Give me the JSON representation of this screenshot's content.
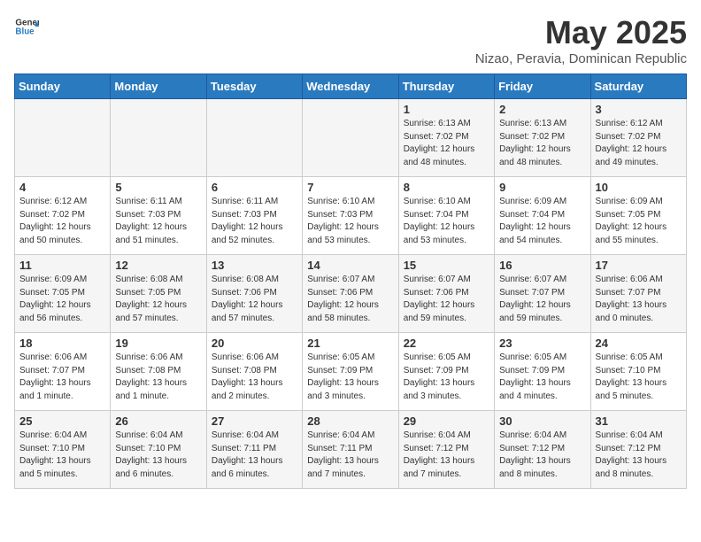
{
  "header": {
    "logo_general": "General",
    "logo_blue": "Blue",
    "title": "May 2025",
    "subtitle": "Nizao, Peravia, Dominican Republic"
  },
  "days_of_week": [
    "Sunday",
    "Monday",
    "Tuesday",
    "Wednesday",
    "Thursday",
    "Friday",
    "Saturday"
  ],
  "weeks": [
    [
      {
        "day": "",
        "info": ""
      },
      {
        "day": "",
        "info": ""
      },
      {
        "day": "",
        "info": ""
      },
      {
        "day": "",
        "info": ""
      },
      {
        "day": "1",
        "info": "Sunrise: 6:13 AM\nSunset: 7:02 PM\nDaylight: 12 hours\nand 48 minutes."
      },
      {
        "day": "2",
        "info": "Sunrise: 6:13 AM\nSunset: 7:02 PM\nDaylight: 12 hours\nand 48 minutes."
      },
      {
        "day": "3",
        "info": "Sunrise: 6:12 AM\nSunset: 7:02 PM\nDaylight: 12 hours\nand 49 minutes."
      }
    ],
    [
      {
        "day": "4",
        "info": "Sunrise: 6:12 AM\nSunset: 7:02 PM\nDaylight: 12 hours\nand 50 minutes."
      },
      {
        "day": "5",
        "info": "Sunrise: 6:11 AM\nSunset: 7:03 PM\nDaylight: 12 hours\nand 51 minutes."
      },
      {
        "day": "6",
        "info": "Sunrise: 6:11 AM\nSunset: 7:03 PM\nDaylight: 12 hours\nand 52 minutes."
      },
      {
        "day": "7",
        "info": "Sunrise: 6:10 AM\nSunset: 7:03 PM\nDaylight: 12 hours\nand 53 minutes."
      },
      {
        "day": "8",
        "info": "Sunrise: 6:10 AM\nSunset: 7:04 PM\nDaylight: 12 hours\nand 53 minutes."
      },
      {
        "day": "9",
        "info": "Sunrise: 6:09 AM\nSunset: 7:04 PM\nDaylight: 12 hours\nand 54 minutes."
      },
      {
        "day": "10",
        "info": "Sunrise: 6:09 AM\nSunset: 7:05 PM\nDaylight: 12 hours\nand 55 minutes."
      }
    ],
    [
      {
        "day": "11",
        "info": "Sunrise: 6:09 AM\nSunset: 7:05 PM\nDaylight: 12 hours\nand 56 minutes."
      },
      {
        "day": "12",
        "info": "Sunrise: 6:08 AM\nSunset: 7:05 PM\nDaylight: 12 hours\nand 57 minutes."
      },
      {
        "day": "13",
        "info": "Sunrise: 6:08 AM\nSunset: 7:06 PM\nDaylight: 12 hours\nand 57 minutes."
      },
      {
        "day": "14",
        "info": "Sunrise: 6:07 AM\nSunset: 7:06 PM\nDaylight: 12 hours\nand 58 minutes."
      },
      {
        "day": "15",
        "info": "Sunrise: 6:07 AM\nSunset: 7:06 PM\nDaylight: 12 hours\nand 59 minutes."
      },
      {
        "day": "16",
        "info": "Sunrise: 6:07 AM\nSunset: 7:07 PM\nDaylight: 12 hours\nand 59 minutes."
      },
      {
        "day": "17",
        "info": "Sunrise: 6:06 AM\nSunset: 7:07 PM\nDaylight: 13 hours\nand 0 minutes."
      }
    ],
    [
      {
        "day": "18",
        "info": "Sunrise: 6:06 AM\nSunset: 7:07 PM\nDaylight: 13 hours\nand 1 minute."
      },
      {
        "day": "19",
        "info": "Sunrise: 6:06 AM\nSunset: 7:08 PM\nDaylight: 13 hours\nand 1 minute."
      },
      {
        "day": "20",
        "info": "Sunrise: 6:06 AM\nSunset: 7:08 PM\nDaylight: 13 hours\nand 2 minutes."
      },
      {
        "day": "21",
        "info": "Sunrise: 6:05 AM\nSunset: 7:09 PM\nDaylight: 13 hours\nand 3 minutes."
      },
      {
        "day": "22",
        "info": "Sunrise: 6:05 AM\nSunset: 7:09 PM\nDaylight: 13 hours\nand 3 minutes."
      },
      {
        "day": "23",
        "info": "Sunrise: 6:05 AM\nSunset: 7:09 PM\nDaylight: 13 hours\nand 4 minutes."
      },
      {
        "day": "24",
        "info": "Sunrise: 6:05 AM\nSunset: 7:10 PM\nDaylight: 13 hours\nand 5 minutes."
      }
    ],
    [
      {
        "day": "25",
        "info": "Sunrise: 6:04 AM\nSunset: 7:10 PM\nDaylight: 13 hours\nand 5 minutes."
      },
      {
        "day": "26",
        "info": "Sunrise: 6:04 AM\nSunset: 7:10 PM\nDaylight: 13 hours\nand 6 minutes."
      },
      {
        "day": "27",
        "info": "Sunrise: 6:04 AM\nSunset: 7:11 PM\nDaylight: 13 hours\nand 6 minutes."
      },
      {
        "day": "28",
        "info": "Sunrise: 6:04 AM\nSunset: 7:11 PM\nDaylight: 13 hours\nand 7 minutes."
      },
      {
        "day": "29",
        "info": "Sunrise: 6:04 AM\nSunset: 7:12 PM\nDaylight: 13 hours\nand 7 minutes."
      },
      {
        "day": "30",
        "info": "Sunrise: 6:04 AM\nSunset: 7:12 PM\nDaylight: 13 hours\nand 8 minutes."
      },
      {
        "day": "31",
        "info": "Sunrise: 6:04 AM\nSunset: 7:12 PM\nDaylight: 13 hours\nand 8 minutes."
      }
    ]
  ]
}
